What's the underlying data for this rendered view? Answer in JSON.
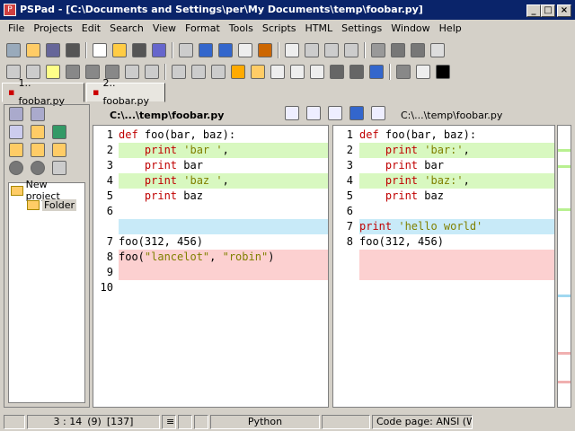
{
  "window": {
    "title": "PSPad - [C:\\Documents and Settings\\per\\My Documents\\temp\\foobar.py]"
  },
  "menu": [
    "File",
    "Projects",
    "Edit",
    "Search",
    "View",
    "Format",
    "Tools",
    "Scripts",
    "HTML",
    "Settings",
    "Window",
    "Help"
  ],
  "toolbar_icons": [
    "new",
    "open",
    "save",
    "print",
    "cut",
    "copy",
    "paste",
    "undo",
    "redo",
    "search",
    "replace",
    "spell",
    "tag",
    "color",
    "console"
  ],
  "tabs": [
    "1.. foobar.py",
    "2.. foobar.py"
  ],
  "project": {
    "root": "New project",
    "folder": "Folder"
  },
  "diff": {
    "left_path": "C:\\...\\temp\\foobar.py",
    "right_path": "C:\\...\\temp\\foobar.py",
    "left_lines": [
      {
        "num": "1",
        "parts": [
          {
            "t": "def ",
            "c": "kw"
          },
          {
            "t": "foo(bar, baz):",
            "c": ""
          }
        ],
        "bg": "#ffffff"
      },
      {
        "num": "2",
        "parts": [
          {
            "t": "    print ",
            "c": "kw"
          },
          {
            "t": "'bar '",
            "c": "st"
          },
          {
            "t": ",",
            "c": ""
          }
        ],
        "bg": "#d8f8c0"
      },
      {
        "num": "3",
        "parts": [
          {
            "t": "    print ",
            "c": "kw"
          },
          {
            "t": "bar",
            "c": ""
          }
        ],
        "bg": "#ffffff"
      },
      {
        "num": "4",
        "parts": [
          {
            "t": "    print ",
            "c": "kw"
          },
          {
            "t": "'baz '",
            "c": "st"
          },
          {
            "t": ",",
            "c": ""
          }
        ],
        "bg": "#d8f8c0"
      },
      {
        "num": "5",
        "parts": [
          {
            "t": "    print ",
            "c": "kw"
          },
          {
            "t": "baz",
            "c": ""
          }
        ],
        "bg": "#ffffff"
      },
      {
        "num": "6",
        "parts": [],
        "bg": "#ffffff"
      },
      {
        "num": "",
        "parts": [],
        "bg": "#c8eaf8"
      },
      {
        "num": "7",
        "parts": [
          {
            "t": "foo(312, 456)",
            "c": ""
          }
        ],
        "bg": "#ffffff"
      },
      {
        "num": "8",
        "parts": [
          {
            "t": "foo(",
            "c": ""
          },
          {
            "t": "\"lancelot\"",
            "c": "st"
          },
          {
            "t": ", ",
            "c": ""
          },
          {
            "t": "\"robin\"",
            "c": "st"
          },
          {
            "t": ")",
            "c": ""
          }
        ],
        "bg": "#fcd0d0"
      },
      {
        "num": "9",
        "parts": [],
        "bg": "#fcd0d0"
      },
      {
        "num": "10",
        "parts": [],
        "bg": "#ffffff"
      }
    ],
    "right_lines": [
      {
        "num": "1",
        "parts": [
          {
            "t": "def ",
            "c": "kw"
          },
          {
            "t": "foo(bar, baz):",
            "c": ""
          }
        ],
        "bg": "#ffffff"
      },
      {
        "num": "2",
        "parts": [
          {
            "t": "    print ",
            "c": "kw"
          },
          {
            "t": "'bar:'",
            "c": "st"
          },
          {
            "t": ",",
            "c": ""
          }
        ],
        "bg": "#d8f8c0"
      },
      {
        "num": "3",
        "parts": [
          {
            "t": "    print ",
            "c": "kw"
          },
          {
            "t": "bar",
            "c": ""
          }
        ],
        "bg": "#ffffff"
      },
      {
        "num": "4",
        "parts": [
          {
            "t": "    print ",
            "c": "kw"
          },
          {
            "t": "'baz:'",
            "c": "st"
          },
          {
            "t": ",",
            "c": ""
          }
        ],
        "bg": "#d8f8c0"
      },
      {
        "num": "5",
        "parts": [
          {
            "t": "    print ",
            "c": "kw"
          },
          {
            "t": "baz",
            "c": ""
          }
        ],
        "bg": "#ffffff"
      },
      {
        "num": "6",
        "parts": [],
        "bg": "#ffffff"
      },
      {
        "num": "7",
        "parts": [
          {
            "t": "print ",
            "c": "kw"
          },
          {
            "t": "'hello world'",
            "c": "st"
          }
        ],
        "bg": "#c8eaf8"
      },
      {
        "num": "8",
        "parts": [
          {
            "t": "foo(312, 456)",
            "c": ""
          }
        ],
        "bg": "#ffffff"
      },
      {
        "num": "",
        "parts": [],
        "bg": "#fcd0d0"
      },
      {
        "num": "",
        "parts": [],
        "bg": "#fcd0d0"
      }
    ]
  },
  "status": {
    "position": "3 : 14",
    "sel": "(9)",
    "code": "[137]",
    "syntax": "Python",
    "codepage": "Code page: ANSI (W"
  },
  "colors": {
    "title_bg": "#0a246a",
    "added": "#d8f8c0",
    "changed": "#c8eaf8",
    "removed": "#fcd0d0"
  }
}
